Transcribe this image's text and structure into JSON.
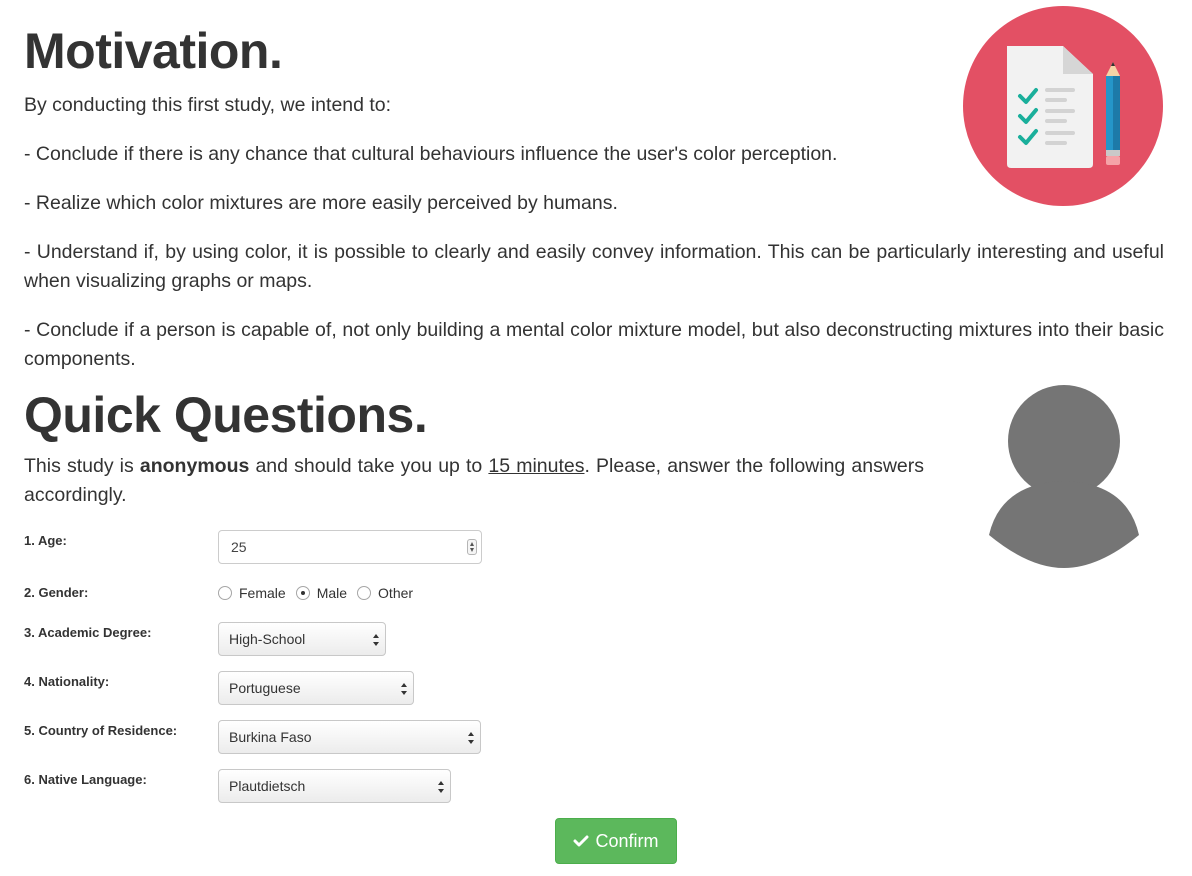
{
  "motivation": {
    "title": "Motivation.",
    "intro": "By conducting this first study, we intend to:",
    "items": [
      "- Conclude if there is any chance that cultural behaviours influence the user's color perception.",
      "- Realize which color mixtures are more easily perceived by humans.",
      "- Understand if, by using color, it is possible to clearly and easily convey information. This can be particularly interesting and useful when visualizing graphs or maps.",
      "- Conclude if a person is capable of, not only building a mental color mixture model, but also deconstructing mixtures into their basic components."
    ],
    "icon": "checklist-clipboard-icon"
  },
  "questions": {
    "title": "Quick Questions.",
    "intro_prefix": "This study is ",
    "intro_bold": "anonymous",
    "intro_middle": " and should take you up to ",
    "intro_underline": "15 minutes",
    "intro_suffix": ". Please, answer the following answers accordingly.",
    "icon": "user-avatar-icon"
  },
  "form": {
    "age": {
      "label": "1. Age:",
      "value": "25"
    },
    "gender": {
      "label": "2. Gender:",
      "options": [
        "Female",
        "Male",
        "Other"
      ],
      "selected": "Male"
    },
    "degree": {
      "label": "3. Academic Degree:",
      "value": "High-School"
    },
    "nationality": {
      "label": "4. Nationality:",
      "value": "Portuguese"
    },
    "residence": {
      "label": "5. Country of Residence:",
      "value": "Burkina Faso"
    },
    "language": {
      "label": "6. Native Language:",
      "value": "Plautdietsch"
    },
    "confirm_label": "Confirm"
  },
  "colors": {
    "accent_red": "#e35064",
    "button_green": "#5cb85c",
    "avatar_gray": "#757575"
  }
}
